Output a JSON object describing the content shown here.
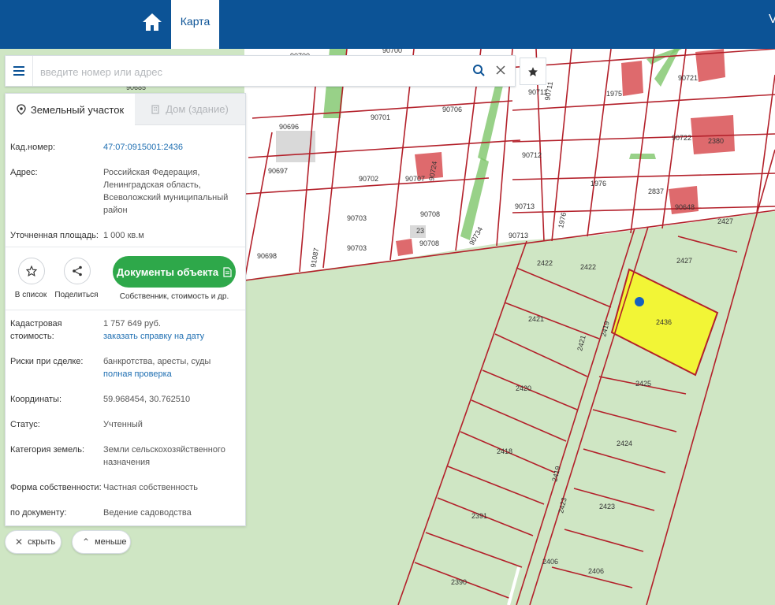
{
  "topbar": {
    "map_tab": "Карта",
    "home_icon": "home-icon",
    "edge_text": "V"
  },
  "search": {
    "placeholder": "введите номер или адрес",
    "value": ""
  },
  "panel": {
    "tab_active": "Земельный участок",
    "tab_inactive": "Дом (здание)",
    "cad_label": "Кад.номер:",
    "cad_value": "47:07:0915001:2436",
    "address_label": "Адрес:",
    "address_value": "Российская Федерация, Ленинградская область, Всеволожский муниципальный район",
    "area_label": "Уточненная площадь:",
    "area_value": "1 000 кв.м",
    "in_list": "В список",
    "share": "Поделиться",
    "docs_button": "Документы объекта",
    "docs_sub": "Собственник, стоимость и др.",
    "cost_label": "Кадастровая стоимость:",
    "cost_value": "1 757 649 руб.",
    "cost_link": "заказать справку на дату",
    "risk_label": "Риски при сделке:",
    "risk_value": "банкротства, аресты, суды",
    "risk_link": "полная проверка",
    "coords_label": "Координаты:",
    "coords_value": "59.968454, 30.762510",
    "status_label": "Статус:",
    "status_value": "Учтенный",
    "category_label": "Категория земель:",
    "category_value": "Земли сельскохозяйственного назначения",
    "ownership_label": "Форма собственности:",
    "ownership_value": "Частная собственность",
    "doc_label": "по документу:",
    "doc_value": "Ведение садоводства"
  },
  "bottom": {
    "hide": "скрыть",
    "less": "меньше"
  },
  "map_labels": {
    "p90685": "90685",
    "p90700": "90700",
    "p90696": "90696",
    "p90701": "90701",
    "p90706": "90706",
    "p90697": "90697",
    "p90702": "90702",
    "p90707": "90707",
    "p90703": "90703",
    "p90708a": "90708",
    "p90698": "90698",
    "p91087": "91087",
    "p90703b": "90703",
    "p90708b": "90708",
    "p23": "23",
    "p90734": "90734",
    "p90711": "90711",
    "p90711v": "90711",
    "p1975": "1975",
    "p90721": "90721",
    "p90712": "90712",
    "p90722": "90722",
    "p2380": "2380",
    "p1976": "1976",
    "p2837": "2837",
    "p90713": "90713",
    "p1976v": "1976",
    "p90713b": "90713",
    "p90648": "90648",
    "p2427a": "2427",
    "p2422a": "2422",
    "p2422b": "2422",
    "p2427b": "2427",
    "p2421": "2421",
    "p2421v": "2421",
    "p2419": "2419",
    "p2436": "2436",
    "p2420": "2420",
    "p2425": "2425",
    "p2418": "2418",
    "p2424": "2424",
    "p2419b": "2419",
    "p2423v": "2423",
    "p2423": "2423",
    "p2391": "2391",
    "p2406a": "2406",
    "p2406b": "2406",
    "p2390": "2390",
    "p90724": "90724",
    "p2404": "2404"
  },
  "colors": {
    "header": "#0c5396",
    "accent": "#2ea84a",
    "link": "#1f6fb2",
    "boundary": "#b3202a",
    "selected": "#f2f536",
    "map_bg": "#cfe6c4"
  }
}
